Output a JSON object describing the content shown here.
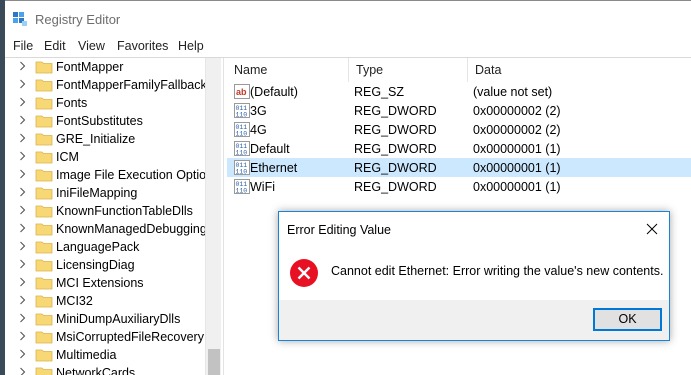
{
  "window": {
    "title": "Registry Editor"
  },
  "menu": [
    "File",
    "Edit",
    "View",
    "Favorites",
    "Help"
  ],
  "tree": {
    "items": [
      "FontMapper",
      "FontMapperFamilyFallback",
      "Fonts",
      "FontSubstitutes",
      "GRE_Initialize",
      "ICM",
      "Image File Execution Option",
      "IniFileMapping",
      "KnownFunctionTableDlls",
      "KnownManagedDebugging",
      "LanguagePack",
      "LicensingDiag",
      "MCI Extensions",
      "MCI32",
      "MiniDumpAuxiliaryDlls",
      "MsiCorruptedFileRecovery",
      "Multimedia",
      "NetworkCards"
    ]
  },
  "values": {
    "columns": [
      "Name",
      "Type",
      "Data"
    ],
    "rows": [
      {
        "name": "(Default)",
        "type": "REG_SZ",
        "data": "(value not set)",
        "icon": "string-value-icon"
      },
      {
        "name": "3G",
        "type": "REG_DWORD",
        "data": "0x00000002 (2)",
        "icon": "binary-value-icon"
      },
      {
        "name": "4G",
        "type": "REG_DWORD",
        "data": "0x00000002 (2)",
        "icon": "binary-value-icon"
      },
      {
        "name": "Default",
        "type": "REG_DWORD",
        "data": "0x00000001 (1)",
        "icon": "binary-value-icon"
      },
      {
        "name": "Ethernet",
        "type": "REG_DWORD",
        "data": "0x00000001 (1)",
        "icon": "binary-value-icon",
        "selected": true
      },
      {
        "name": "WiFi",
        "type": "REG_DWORD",
        "data": "0x00000001 (1)",
        "icon": "binary-value-icon"
      }
    ]
  },
  "dialog": {
    "title": "Error Editing Value",
    "message": "Cannot edit Ethernet:  Error writing the value's new contents.",
    "ok_label": "OK",
    "icon": "error-icon"
  },
  "colors": {
    "selection": "#cce8ff",
    "accent": "#0078d7",
    "error": "#e81123",
    "folder": "#f8d775"
  }
}
